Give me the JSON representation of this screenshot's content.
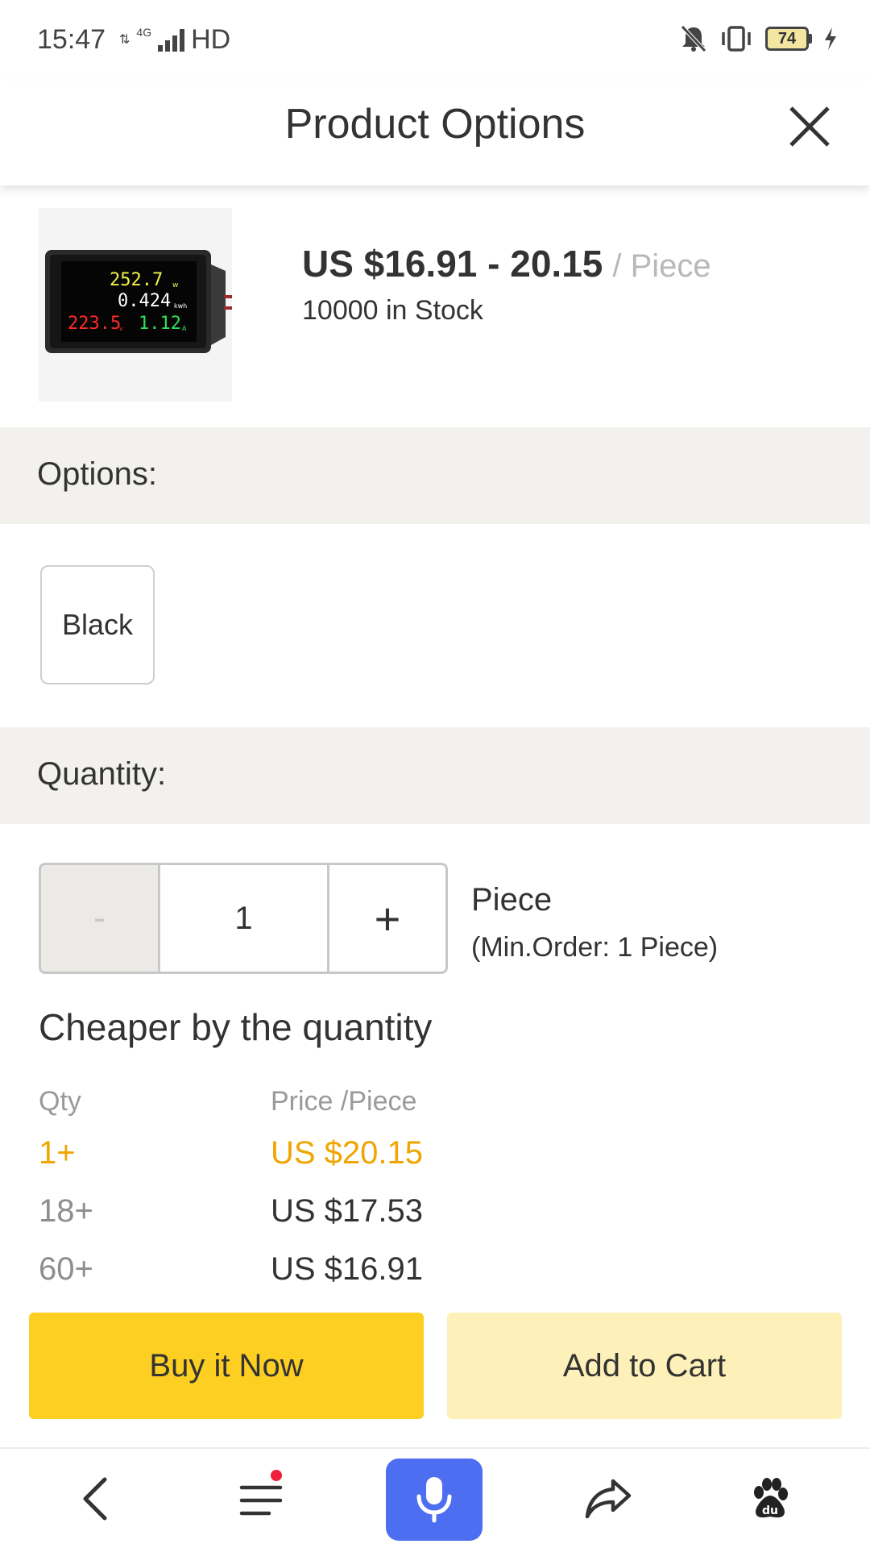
{
  "status_bar": {
    "time": "15:47",
    "network": "4G",
    "hd": "HD",
    "battery": "74"
  },
  "header": {
    "title": "Product Options"
  },
  "product": {
    "price": "US $16.91 - 20.15",
    "price_unit": "/ Piece",
    "stock": "10000 in Stock",
    "meter_readings": {
      "power": "252.7",
      "energy": "0.424",
      "voltage": "223.5",
      "current": "1.12",
      "power_unit": "w",
      "energy_unit": "kwh",
      "voltage_unit": "v",
      "current_unit": "A"
    }
  },
  "options": {
    "label": "Options:",
    "choices": [
      "Black"
    ]
  },
  "quantity": {
    "label": "Quantity:",
    "minus": "-",
    "value": "1",
    "plus": "+",
    "unit": "Piece",
    "min_order": "(Min.Order: 1 Piece)"
  },
  "tiers": {
    "title": "Cheaper by the quantity",
    "col_qty": "Qty",
    "col_price": "Price /Piece",
    "rows": [
      {
        "qty": "1+",
        "price": "US $20.15"
      },
      {
        "qty": "18+",
        "price": "US $17.53"
      },
      {
        "qty": "60+",
        "price": "US $16.91"
      }
    ]
  },
  "actions": {
    "buy_now": "Buy it Now",
    "add_to_cart": "Add to Cart"
  },
  "colors": {
    "accent_yellow": "#fccf22",
    "light_yellow": "#fdf0b8",
    "tier_highlight": "#f0a500",
    "mic_blue": "#4e6ef2",
    "section_bg": "#f2f1ed"
  }
}
